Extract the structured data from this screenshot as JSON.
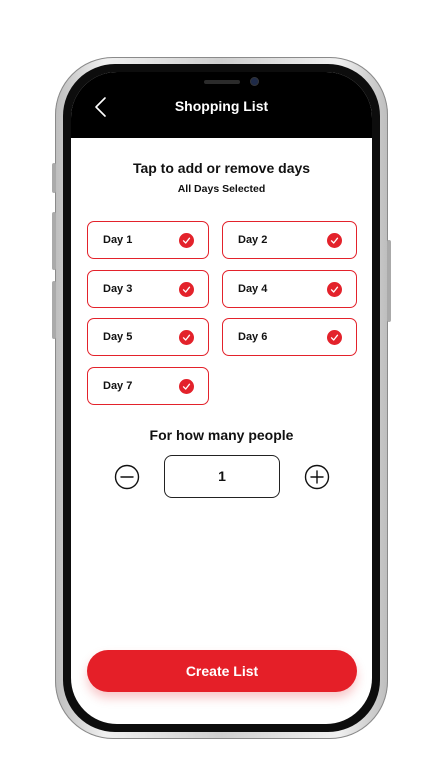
{
  "header": {
    "title": "Shopping List",
    "back_icon": "chevron-left-icon"
  },
  "days_section": {
    "instruction": "Tap to add or remove days",
    "status": "All Days Selected",
    "days": [
      {
        "label": "Day 1",
        "selected": true
      },
      {
        "label": "Day 2",
        "selected": true
      },
      {
        "label": "Day 3",
        "selected": true
      },
      {
        "label": "Day 4",
        "selected": true
      },
      {
        "label": "Day 5",
        "selected": true
      },
      {
        "label": "Day 6",
        "selected": true
      },
      {
        "label": "Day 7",
        "selected": true
      }
    ]
  },
  "people_section": {
    "question": "For how many people",
    "count": "1",
    "decrement_icon": "minus-circle-icon",
    "increment_icon": "plus-circle-icon"
  },
  "footer": {
    "create_label": "Create List"
  },
  "colors": {
    "accent": "#e3222b",
    "header_bg": "#000000",
    "screen_bg": "#ffffff"
  }
}
